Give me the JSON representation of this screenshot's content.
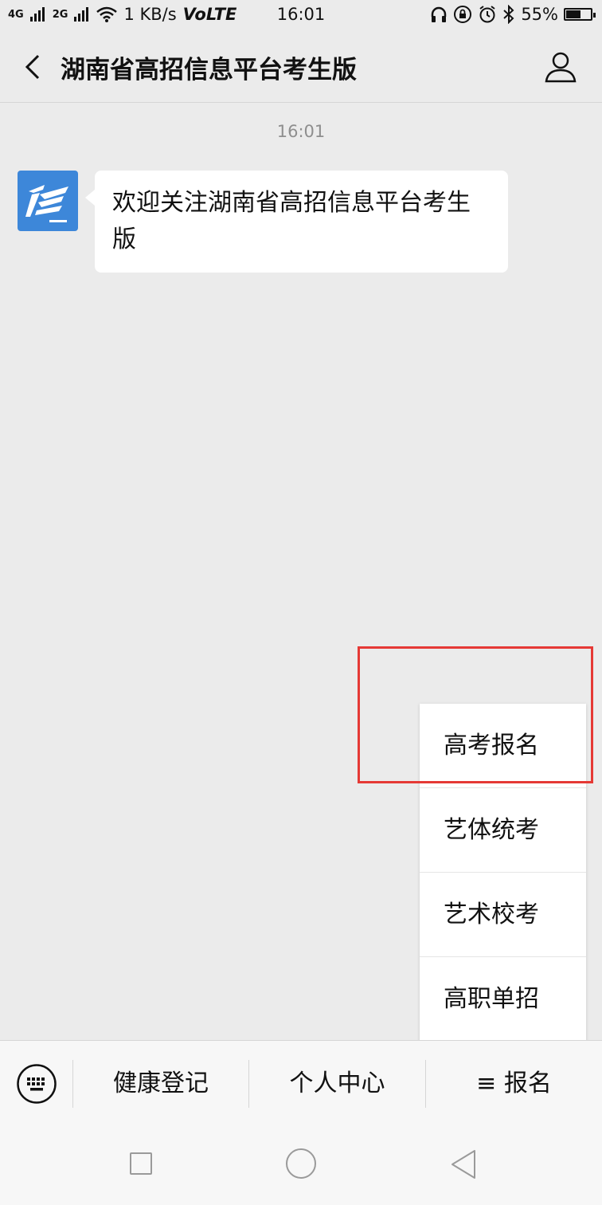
{
  "status_bar": {
    "signal_1": "4G",
    "signal_2": "2G",
    "network_speed": "1 KB/s",
    "volte": "VoLTE",
    "time": "16:01",
    "battery": "55%",
    "battery_level": 0.55,
    "icons": [
      "headphones-icon",
      "rotation-lock-icon",
      "alarm-icon",
      "bluetooth-icon",
      "wifi-icon"
    ]
  },
  "header": {
    "title": "湖南省高招信息平台考生版"
  },
  "chat": {
    "timestamp": "16:01",
    "message": "欢迎关注湖南省高招信息平台考生版"
  },
  "popup_menu": {
    "items": [
      "高考报名",
      "艺体统考",
      "艺术校考",
      "高职单招"
    ]
  },
  "bottom_menu": {
    "items": [
      "健康登记",
      "个人中心",
      "≡ 报名"
    ]
  },
  "colors": {
    "background": "#ebebeb",
    "avatar_blue": "#3d87d9",
    "highlight_red": "#e53935"
  }
}
